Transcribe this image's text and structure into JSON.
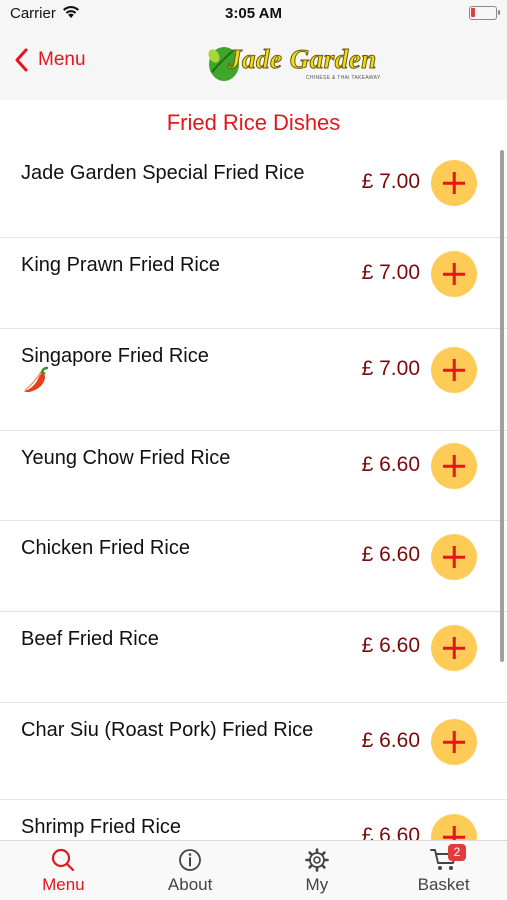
{
  "status_bar": {
    "carrier": "Carrier",
    "time": "3:05 AM"
  },
  "nav": {
    "back_label": "Menu",
    "logo_text": "Jade Garden",
    "logo_tagline": "CHINESE & THAI TAKEAWAY"
  },
  "section_title": "Fried Rice Dishes",
  "items": [
    {
      "name": "Jade Garden Special Fried Rice",
      "price": "£ 7.00"
    },
    {
      "name": "King Prawn Fried Rice",
      "price": "£ 7.00"
    },
    {
      "name": "Singapore Fried Rice",
      "price": "£ 7.00",
      "icon": "chili-pepper-icon"
    },
    {
      "name": "Yeung Chow Fried Rice",
      "price": "£ 6.60"
    },
    {
      "name": "Chicken Fried Rice",
      "price": "£ 6.60"
    },
    {
      "name": "Beef Fried Rice",
      "price": "£ 6.60"
    },
    {
      "name": "Char Siu (Roast Pork) Fried Rice",
      "price": "£ 6.60"
    },
    {
      "name": "Shrimp Fried Rice",
      "price": "£ 6.60"
    }
  ],
  "tabs": [
    {
      "label": "Menu",
      "icon": "search-icon",
      "active": true
    },
    {
      "label": "About",
      "icon": "info-icon"
    },
    {
      "label": "My",
      "icon": "gear-icon"
    },
    {
      "label": "Basket",
      "icon": "cart-icon",
      "badge": "2"
    }
  ],
  "colors": {
    "accent": "#e4161d",
    "price": "#7a0a0a",
    "add_button": "#ffcb57"
  }
}
